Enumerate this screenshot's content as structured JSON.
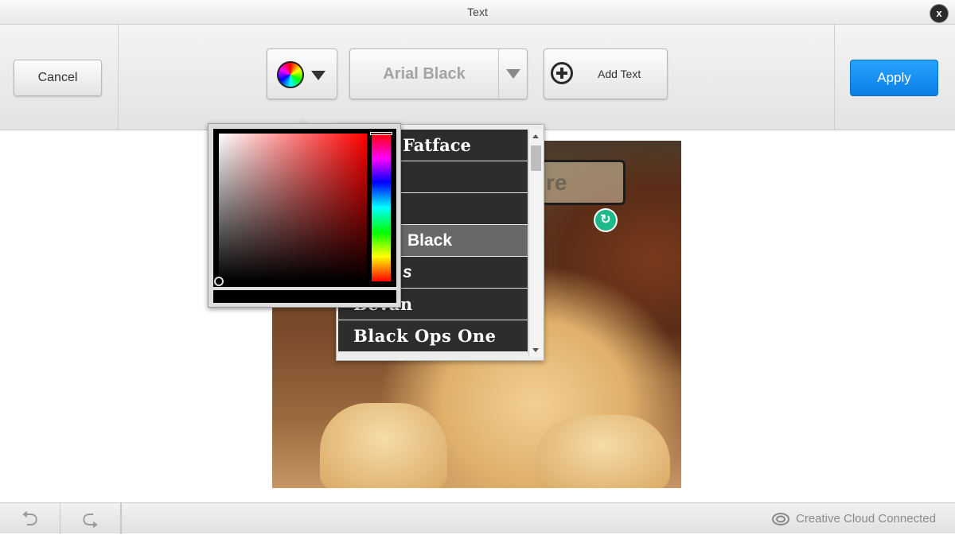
{
  "window": {
    "title": "Text",
    "close_label": "x"
  },
  "toolbar": {
    "cancel_label": "Cancel",
    "apply_label": "Apply",
    "font_selected": "Arial Black",
    "add_text_label": "Add Text"
  },
  "canvas": {
    "text_box_text": "re",
    "rotate_glyph": "↻"
  },
  "font_list": {
    "items": [
      "Fatface",
      "",
      "",
      "Black",
      "s",
      "Bevan",
      "Black Ops One"
    ],
    "selected_index": 3
  },
  "color_picker": {
    "current_color": "#000000",
    "hue": "#ff0000"
  },
  "footer": {
    "undo_glyph": "⮌",
    "redo_glyph": "⮎",
    "status_label": "Creative Cloud Connected"
  },
  "colors": {
    "accent": "#1a8ff0",
    "rotate_handle": "#1fba8a"
  }
}
